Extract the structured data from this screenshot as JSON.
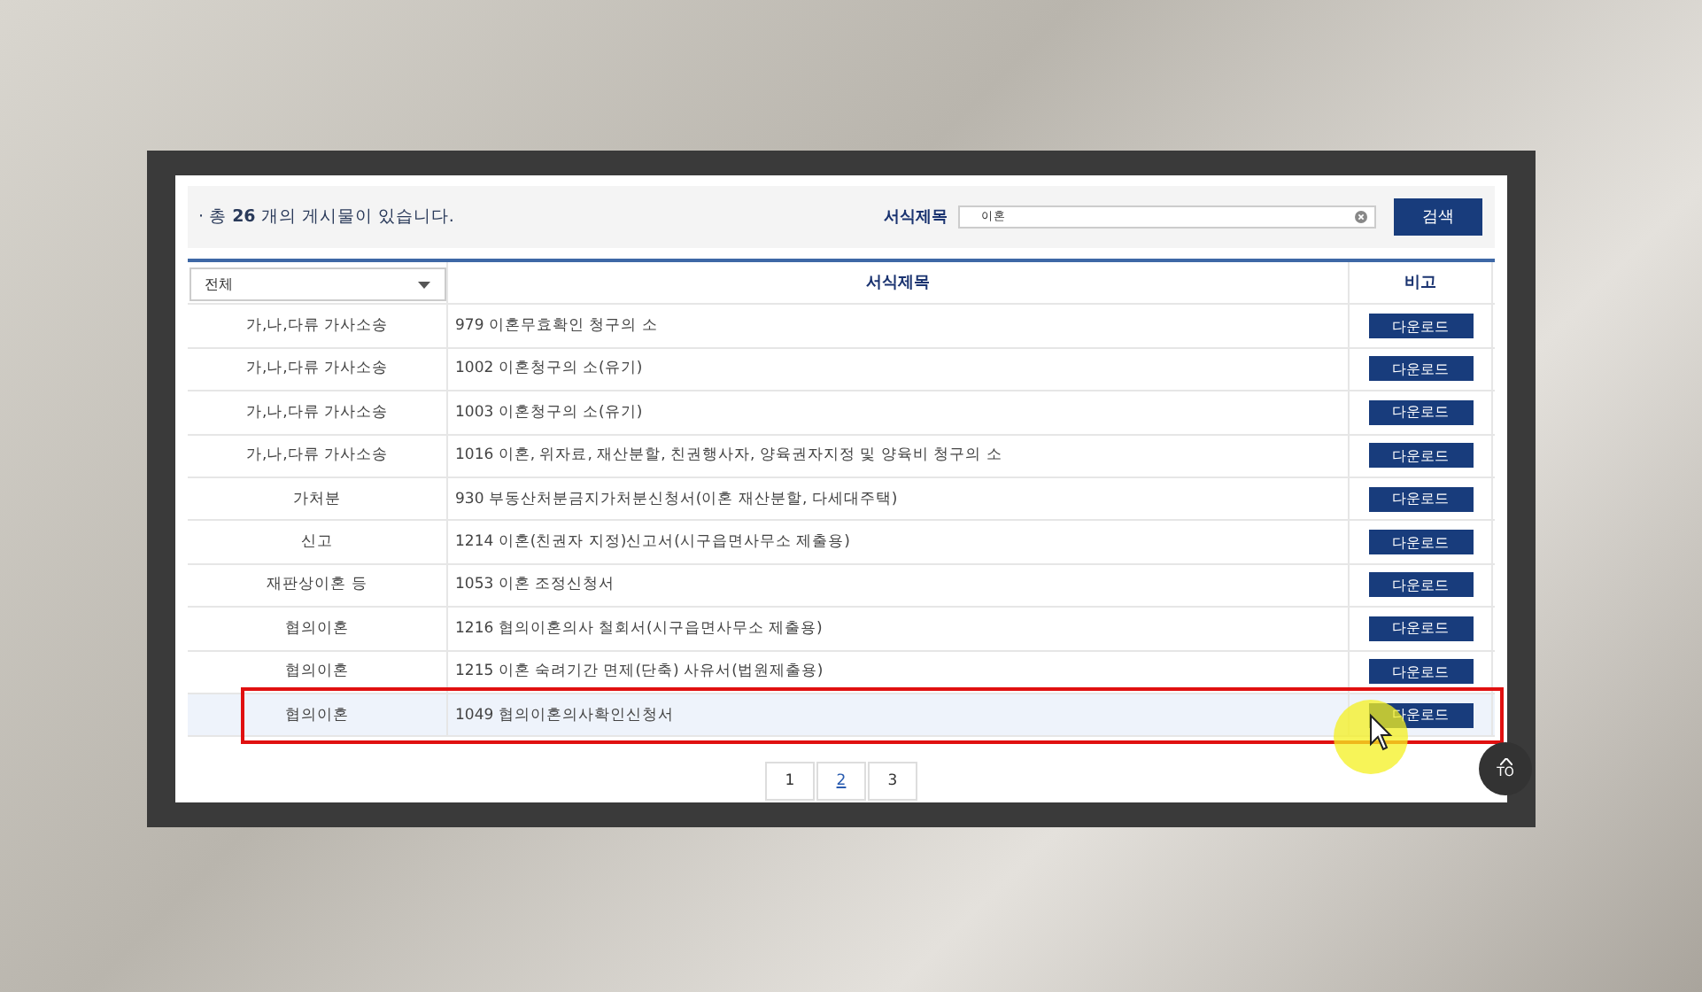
{
  "summary": {
    "prefix": "· 총 ",
    "count": "26",
    "suffix": " 개의 게시물이 있습니다."
  },
  "search": {
    "label": "서식제목",
    "value": "이혼",
    "button": "검색"
  },
  "table": {
    "filter": "전체",
    "columns": [
      "서식제목",
      "비고"
    ],
    "rows": [
      {
        "category": "가,나,다류 가사소송",
        "title": "979 이혼무효확인 청구의 소",
        "action": "다운로드",
        "highlighted": false
      },
      {
        "category": "가,나,다류 가사소송",
        "title": "1002 이혼청구의 소(유기)",
        "action": "다운로드",
        "highlighted": false
      },
      {
        "category": "가,나,다류 가사소송",
        "title": "1003 이혼청구의 소(유기)",
        "action": "다운로드",
        "highlighted": false
      },
      {
        "category": "가,나,다류 가사소송",
        "title": "1016 이혼, 위자료, 재산분할, 친권행사자, 양육권자지정 및 양육비 청구의 소",
        "action": "다운로드",
        "highlighted": false
      },
      {
        "category": "가처분",
        "title": "930 부동산처분금지가처분신청서(이혼 재산분할, 다세대주택)",
        "action": "다운로드",
        "highlighted": false
      },
      {
        "category": "신고",
        "title": "1214 이혼(친권자 지정)신고서(시구읍면사무소 제출용)",
        "action": "다운로드",
        "highlighted": false
      },
      {
        "category": "재판상이혼 등",
        "title": "1053 이혼 조정신청서",
        "action": "다운로드",
        "highlighted": false
      },
      {
        "category": "협의이혼",
        "title": "1216 협의이혼의사 철회서(시구읍면사무소 제출용)",
        "action": "다운로드",
        "highlighted": false
      },
      {
        "category": "협의이혼",
        "title": "1215 이혼 숙려기간 면제(단축) 사유서(법원제출용)",
        "action": "다운로드",
        "highlighted": false
      },
      {
        "category": "협의이혼",
        "title": "1049 협의이혼의사확인신청서",
        "action": "다운로드",
        "highlighted": true
      }
    ]
  },
  "pagination": [
    {
      "label": "1",
      "selected": false
    },
    {
      "label": "2",
      "selected": true
    },
    {
      "label": "3",
      "selected": false
    }
  ],
  "top_button": {
    "label": "TO"
  }
}
